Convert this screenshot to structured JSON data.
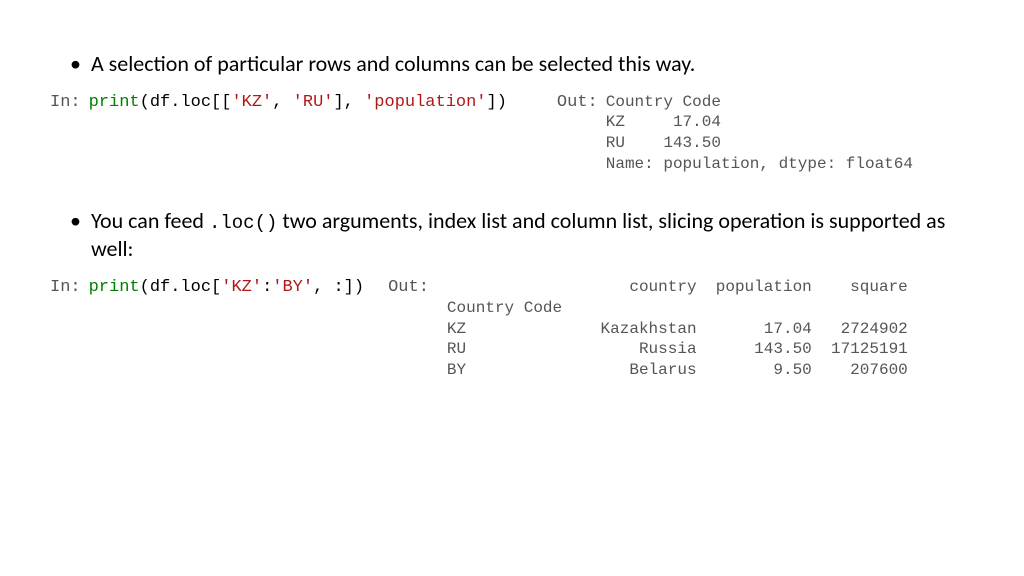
{
  "bullet1": "A selection of particular rows and columns can be selected this way.",
  "bullet2_a": "You can feed ",
  "bullet2_code": ".loc()",
  "bullet2_b": " two arguments, index list and column list, slicing operation is supported as well:",
  "labels": {
    "in": "In:",
    "out": "Out:"
  },
  "codeA": {
    "p_print": "print",
    "p_open": "(df.loc[[",
    "s_kz": "'KZ'",
    "p_comma": ", ",
    "s_ru": "'RU'",
    "p_mid": "], ",
    "s_pop": "'population'",
    "p_close": "])"
  },
  "outA": "Country Code\nKZ     17.04\nRU    143.50\nName: population, dtype: float64",
  "codeB": {
    "p_print": "print",
    "p_open": "(df.loc[",
    "s_kz": "'KZ'",
    "p_colon": ":",
    "s_by": "'BY'",
    "p_close": ", :])"
  },
  "outB": "                   country  population    square\nCountry Code                                     \nKZ              Kazakhstan       17.04   2724902\nRU                  Russia      143.50  17125191\nBY                 Belarus        9.50    207600"
}
